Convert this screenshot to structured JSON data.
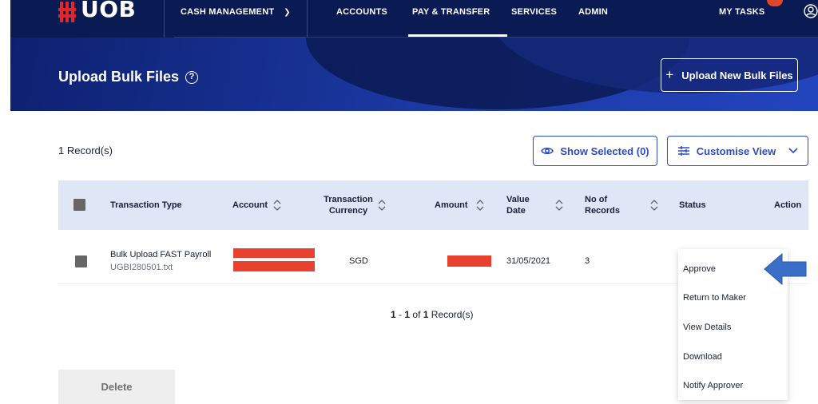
{
  "brand": {
    "logo_text": "UOB",
    "logo_color": "#e0262b"
  },
  "nav": {
    "cash_management": "CASH MANAGEMENT",
    "accounts": "ACCOUNTS",
    "pay_transfer": "PAY & TRANSFER",
    "services": "SERVICES",
    "admin": "ADMIN",
    "my_tasks": "MY TASKS",
    "active_item": "PAY & TRANSFER"
  },
  "hero": {
    "title": "Upload Bulk Files",
    "upload_button": "Upload New Bulk Files"
  },
  "toolbar": {
    "record_count": "1 Record(s)",
    "show_selected": "Show Selected (0)",
    "customise_view": "Customise View"
  },
  "table": {
    "headers": {
      "transaction_type": "Transaction Type",
      "account": "Account",
      "transaction_currency_1": "Transaction",
      "transaction_currency_2": "Currency",
      "amount": "Amount",
      "value_date_1": "Value",
      "value_date_2": "Date",
      "no_of_records_1": "No of",
      "no_of_records_2": "Records",
      "status": "Status",
      "action": "Action"
    },
    "rows": [
      {
        "transaction_type": "Bulk Upload FAST Payroll",
        "file_name": "UGBI280501.txt",
        "currency": "SGD",
        "value_date": "31/05/2021",
        "no_of_records": "3"
      }
    ]
  },
  "pagination": {
    "from": "1",
    "to": "1",
    "of_text": "of",
    "total": "1",
    "suffix": "Record(s)"
  },
  "actions": {
    "delete": "Delete",
    "menu": [
      "Approve",
      "Return to Maker",
      "View Details",
      "Download",
      "Notify Approver"
    ]
  },
  "colors": {
    "nav_bg": "#0a1a52",
    "accent": "#2c4cc8",
    "header_bg": "#dfe6f5",
    "redaction": "#e8412f",
    "arrow": "#3b6fc7"
  }
}
